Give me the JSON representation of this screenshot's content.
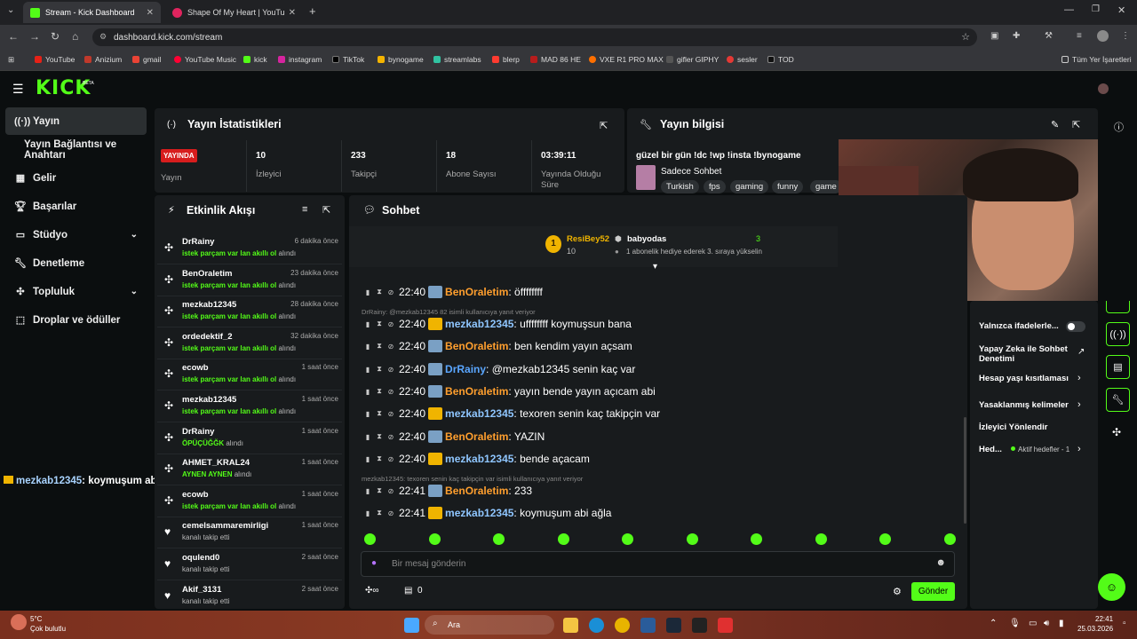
{
  "browser": {
    "tabs": [
      {
        "title": "Stream - Kick Dashboard"
      },
      {
        "title": "Shape Of My Heart | YouTu"
      }
    ],
    "url": "dashboard.kick.com/stream",
    "bookmarks": [
      "YouTube",
      "Anizium",
      "gmail",
      "YouTube Music",
      "kick",
      "instagram",
      "TikTok",
      "bynogame",
      "streamlabs",
      "blerp",
      "MAD 86 HE",
      "VXE R1 PRO MAX",
      "gifler GIPHY",
      "sesler",
      "TOD"
    ],
    "all_bookmarks": "Tüm Yer İşaretleri"
  },
  "brand": {
    "logo": "KICK",
    "beta": "BETA"
  },
  "sidebar": {
    "items": [
      {
        "label": "Yayın"
      },
      {
        "label": "Yayın Bağlantısı ve Anahtarı"
      },
      {
        "label": "Gelir"
      },
      {
        "label": "Başarılar"
      },
      {
        "label": "Stüdyo"
      },
      {
        "label": "Denetleme"
      },
      {
        "label": "Topluluk"
      },
      {
        "label": "Droplar ve ödüller"
      }
    ]
  },
  "stats": {
    "title": "Yayın İstatistikleri",
    "live_badge": "YAYINDA",
    "live_label": "Yayın",
    "items": [
      {
        "value": "10",
        "label": "İzleyici"
      },
      {
        "value": "233",
        "label": "Takipçi"
      },
      {
        "value": "18",
        "label": "Abone Sayısı"
      },
      {
        "value": "03:39:11",
        "label": "Yayında Olduğu Süre"
      }
    ]
  },
  "stream_info": {
    "title": "Yayın bilgisi",
    "stream_title": "güzel bir gün !dc !wp !insta !bynogame",
    "category": "Sadece Sohbet",
    "tags": [
      "Turkish",
      "fps",
      "gaming",
      "funny",
      "game"
    ]
  },
  "activity": {
    "title": "Etkinlik Akışı",
    "items": [
      {
        "user": "DrRainy",
        "time": "6 dakika önce",
        "reward": "istek parçam var lan akıllı ol",
        "suffix": "alındı"
      },
      {
        "user": "BenOraletim",
        "time": "23 dakika önce",
        "reward": "istek parçam var lan akıllı ol",
        "suffix": "alındı"
      },
      {
        "user": "mezkab12345",
        "time": "28 dakika önce",
        "reward": "istek parçam var lan akıllı ol",
        "suffix": "alındı"
      },
      {
        "user": "ordedektif_2",
        "time": "32 dakika önce",
        "reward": "istek parçam var lan akıllı ol",
        "suffix": "alındı"
      },
      {
        "user": "ecowb",
        "time": "1 saat önce",
        "reward": "istek parçam var lan akıllı ol",
        "suffix": "alındı"
      },
      {
        "user": "mezkab12345",
        "time": "1 saat önce",
        "reward": "istek parçam var lan akıllı ol",
        "suffix": "alındı"
      },
      {
        "user": "DrRainy",
        "time": "1 saat önce",
        "reward": "ÖPÜÇÜĞĞK",
        "suffix": "alındı"
      },
      {
        "user": "AHMET_KRAL24",
        "time": "1 saat önce",
        "reward": "AYNEN AYNEN",
        "suffix": "alındı"
      },
      {
        "user": "ecowb",
        "time": "1 saat önce",
        "reward": "istek parçam var lan akıllı ol",
        "suffix": "alındı"
      },
      {
        "user": "cemelsammaremirligi",
        "time": "1 saat önce",
        "reward": "",
        "suffix": "kanalı takip etti"
      },
      {
        "user": "oqulend0",
        "time": "2 saat önce",
        "reward": "",
        "suffix": "kanalı takip etti"
      },
      {
        "user": "Akif_3131",
        "time": "2 saat önce",
        "reward": "",
        "suffix": "kanalı takip etti"
      }
    ]
  },
  "chat": {
    "title": "Sohbet",
    "leader": {
      "rank": "1",
      "user": "ResiBey52",
      "count": "10",
      "gifter": "babyodas",
      "gift_count": "3",
      "gift_note": "1 abonelik hediye ederek 3. sıraya yükselin"
    },
    "messages": [
      {
        "time": "22:40",
        "user": "BenOraletim",
        "text": ": öffffffff",
        "color": "#ff9f2e",
        "crown": false
      },
      {
        "time": "22:40",
        "user": "mezkab12345",
        "text": ": uffffffff koymuşsun bana",
        "color": "#8fc6ff",
        "crown": true
      },
      {
        "time": "22:40",
        "user": "BenOraletim",
        "text": ": ben kendim yayın açsam",
        "color": "#ff9f2e",
        "crown": false
      },
      {
        "time": "22:40",
        "user": "DrRainy",
        "text": ": @mezkab12345 senin kaç var",
        "color": "#5aa6ff",
        "crown": false
      },
      {
        "time": "22:40",
        "user": "BenOraletim",
        "text": ": yayın bende yayın açıcam abi",
        "color": "#ff9f2e",
        "crown": false
      },
      {
        "time": "22:40",
        "user": "mezkab12345",
        "text": ": texoren senin kaç takipçin var",
        "color": "#8fc6ff",
        "crown": true
      },
      {
        "time": "22:40",
        "user": "BenOraletim",
        "text": ": YAZIN",
        "color": "#ff9f2e",
        "crown": false
      },
      {
        "time": "22:40",
        "user": "mezkab12345",
        "text": ": bende açacam",
        "color": "#8fc6ff",
        "crown": true
      },
      {
        "time": "22:41",
        "user": "BenOraletim",
        "text": ": 233",
        "color": "#ff9f2e",
        "crown": false
      },
      {
        "time": "22:41",
        "user": "mezkab12345",
        "text": ": koymuşum abi ağla",
        "color": "#8fc6ff",
        "crown": true
      }
    ],
    "reply1": "DrRainy: @mezkab12345 82 isimli kullanıcıya yanıt veriyor",
    "reply2": "mezkab12345: texoren senin kaç takipçin var isimli kullanıcıya yanıt veriyor",
    "input_placeholder": "Bir mesaj gönderin",
    "send_label": "Gönder",
    "points": "0"
  },
  "overlay_msg": {
    "user": "mezkab12345",
    "text": ": koymuşum abi ağla"
  },
  "settings": {
    "items": [
      {
        "label": "Yalnızca ifadelerle..."
      },
      {
        "label": "Yapay Zeka ile Sohbet Denetimi"
      },
      {
        "label": "Hesap yaşı kısıtlaması"
      },
      {
        "label": "Yasaklanmış kelimeler"
      },
      {
        "label": "İzleyici Yönlendir"
      },
      {
        "label": "Hed..."
      }
    ],
    "goal_note": "Aktif hedefler - 1"
  },
  "taskbar": {
    "weather_temp": "5°C",
    "weather_desc": "Çok bulutlu",
    "search": "Ara",
    "time": "22:41",
    "date": "25.03.2026"
  },
  "colors": {
    "accent": "#53fc18",
    "panel": "#181b1d",
    "live": "#d71d1d"
  }
}
